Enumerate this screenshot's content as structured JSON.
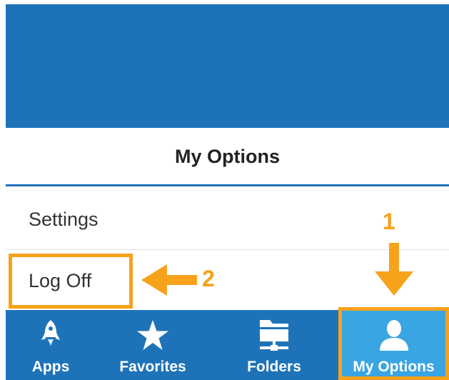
{
  "panel": {
    "title": "My Options",
    "items": [
      {
        "label": "Settings"
      },
      {
        "label": "Log Off"
      }
    ]
  },
  "tabbar": {
    "tabs": [
      {
        "label": "Apps",
        "icon": "rocket-icon"
      },
      {
        "label": "Favorites",
        "icon": "star-icon"
      },
      {
        "label": "Folders",
        "icon": "network-folder-icon"
      },
      {
        "label": "My Options",
        "icon": "user-icon",
        "active": true
      }
    ]
  },
  "annotations": {
    "step1": "1",
    "step2": "2"
  },
  "colors": {
    "brand_blue": "#1e73b8",
    "active_tab": "#3aa5e3",
    "annotation_orange": "#f7a21b"
  }
}
